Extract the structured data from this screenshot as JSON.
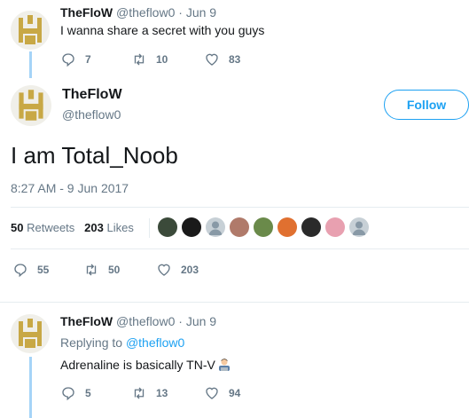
{
  "tweet1": {
    "name": "TheFloW",
    "handle": "@theflow0",
    "dot": "·",
    "date": "Jun 9",
    "text": "I wanna share a secret with you guys",
    "replies": "7",
    "retweets": "10",
    "likes": "83"
  },
  "main": {
    "name": "TheFloW",
    "handle": "@theflow0",
    "follow_label": "Follow",
    "text": "I am Total_Noob",
    "timestamp": "8:27 AM - 9 Jun 2017",
    "retweets_count": "50",
    "retweets_label": "Retweets",
    "likes_count": "203",
    "likes_label": "Likes",
    "likers": [
      "#3b4a3a",
      "#1a1a1a",
      "#c7d0d6",
      "#b07a6a",
      "#6a8a4a",
      "#e07030",
      "#2a2a2a",
      "#e8a0b0",
      "#c7d0d6"
    ],
    "replies": "55",
    "retweets": "50",
    "likes": "203"
  },
  "reply": {
    "name": "TheFloW",
    "handle": "@theflow0",
    "dot": "·",
    "date": "Jun 9",
    "replying_prefix": "Replying to",
    "replying_to": "@theflow0",
    "text": "Adrenaline is basically TN-V",
    "emoji": "man-technologist-emoji",
    "replies": "5",
    "retweets": "13",
    "likes": "94"
  },
  "colors": {
    "accent": "#1da1f2",
    "muted": "#657786",
    "thread_line": "#a5d4f7",
    "avatar_gold": "#c8a845"
  }
}
